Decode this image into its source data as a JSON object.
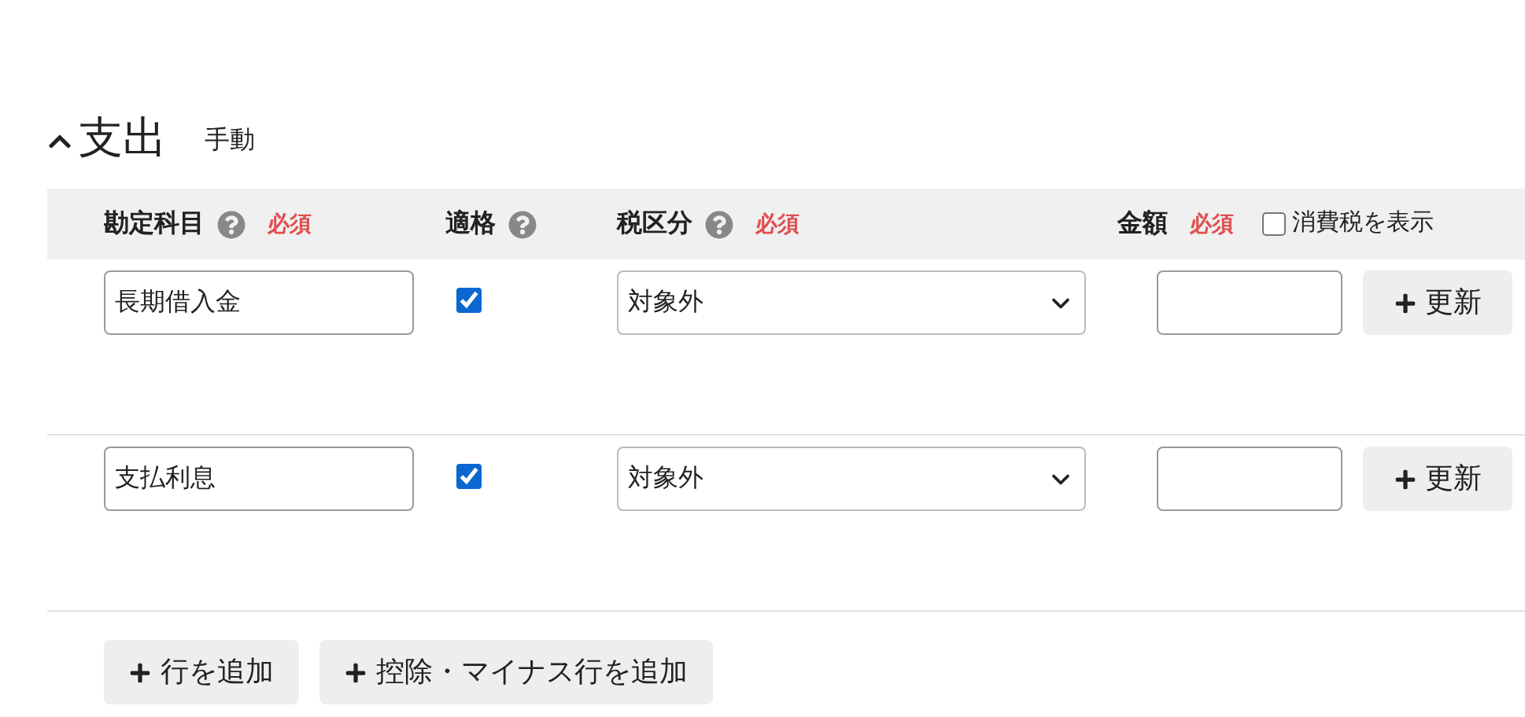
{
  "section": {
    "title": "支出",
    "mode": "手動",
    "expanded": true
  },
  "columns": [
    {
      "label": "勘定科目",
      "help": true,
      "required": "必須"
    },
    {
      "label": "適格",
      "help": true
    },
    {
      "label": "税区分",
      "help": true,
      "required": "必須"
    },
    {
      "label": "金額",
      "help": false,
      "required": "必須"
    }
  ],
  "tax_display": {
    "label": "消費税を表示",
    "checked": false
  },
  "rows": [
    {
      "account": "長期借入金",
      "qualified": true,
      "tax_category": "対象外",
      "update_label": "更新"
    },
    {
      "account": "支払利息",
      "qualified": true,
      "tax_category": "対象外",
      "update_label": "更新"
    }
  ],
  "buttons": [
    "行を追加",
    "控除・マイナス行を追加"
  ]
}
